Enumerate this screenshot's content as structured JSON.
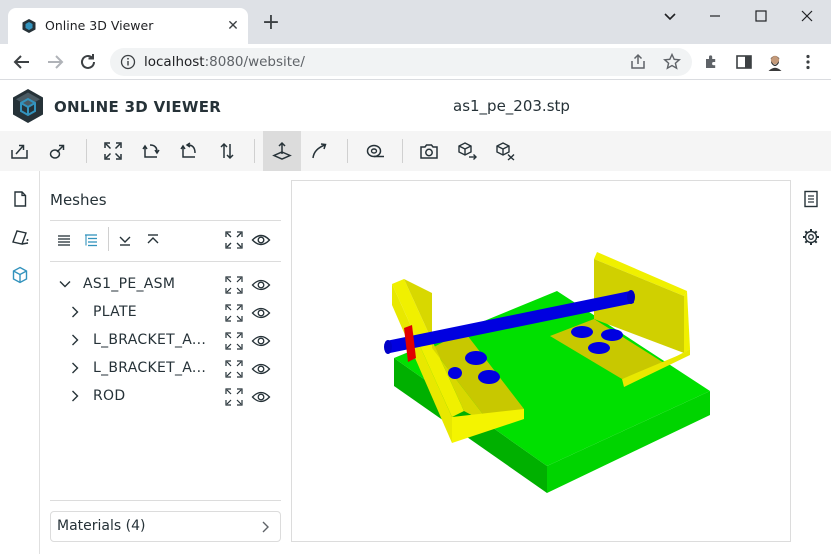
{
  "browser": {
    "tab_title": "Online 3D Viewer",
    "url_host": "localhost",
    "url_rest": ":8080/website/"
  },
  "app": {
    "title": "ONLINE 3D VIEWER",
    "file_name": "as1_pe_203.stp"
  },
  "toolbar": {
    "buttons": [
      {
        "icon": "open-file-icon"
      },
      {
        "icon": "open-url-icon"
      },
      {
        "icon": "fit-to-window-icon"
      },
      {
        "icon": "set-up-vector-icon"
      },
      {
        "icon": "flip-up-vector-icon"
      },
      {
        "icon": "fix-up-vector-icon"
      },
      {
        "icon": "navigation-fixed-up-icon"
      },
      {
        "icon": "navigation-free-orbit-icon"
      },
      {
        "icon": "measure-icon"
      },
      {
        "icon": "snapshot-icon"
      },
      {
        "icon": "export-icon"
      },
      {
        "icon": "share-icon"
      }
    ]
  },
  "left_sidebar": {
    "buttons": [
      {
        "icon": "file-details-icon"
      },
      {
        "icon": "materials-icon"
      },
      {
        "icon": "meshes-icon"
      }
    ]
  },
  "meshes_panel": {
    "title": "Meshes",
    "tree": [
      {
        "label": "AS1_PE_ASM",
        "expanded": true,
        "level": 0
      },
      {
        "label": "PLATE",
        "expanded": false,
        "level": 1
      },
      {
        "label": "L_BRACKET_A...",
        "expanded": false,
        "level": 1
      },
      {
        "label": "L_BRACKET_A...",
        "expanded": false,
        "level": 1
      },
      {
        "label": "ROD",
        "expanded": false,
        "level": 1
      }
    ],
    "materials_label": "Materials (4)"
  },
  "right_sidebar": {
    "buttons": [
      {
        "icon": "details-icon"
      },
      {
        "icon": "settings-icon"
      }
    ]
  },
  "colors": {
    "accent": "#3393bd",
    "plate": "#00e000",
    "bracket": "#e8e800",
    "rod": "#0000e0",
    "nut": "#e00000"
  }
}
